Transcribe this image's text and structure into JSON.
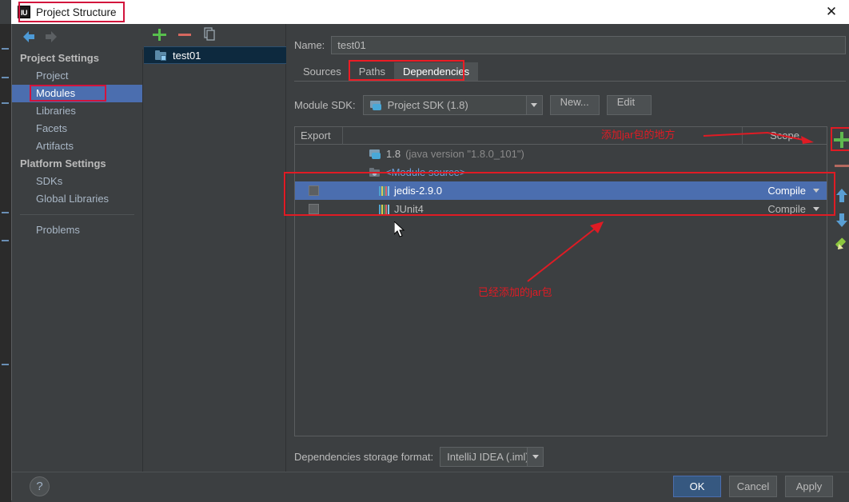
{
  "window": {
    "title": "Project Structure",
    "app_icon": "IU",
    "close_icon": "✕"
  },
  "nav": {
    "back_icon": "back-arrow-icon",
    "forward_icon": "forward-arrow-icon"
  },
  "sidebar": {
    "groups": [
      {
        "header": "Project Settings",
        "items": [
          {
            "label": "Project",
            "selected": false
          },
          {
            "label": "Modules",
            "selected": true
          },
          {
            "label": "Libraries",
            "selected": false
          },
          {
            "label": "Facets",
            "selected": false
          },
          {
            "label": "Artifacts",
            "selected": false
          }
        ]
      },
      {
        "header": "Platform Settings",
        "items": [
          {
            "label": "SDKs",
            "selected": false
          },
          {
            "label": "Global Libraries",
            "selected": false
          }
        ]
      }
    ],
    "problems_label": "Problems"
  },
  "module_panel": {
    "toolbar": {
      "add_icon": "plus-icon",
      "remove_icon": "minus-icon",
      "copy_icon": "copy-icon"
    },
    "modules": [
      {
        "name": "test01",
        "selected": true
      }
    ]
  },
  "main": {
    "name_label": "Name:",
    "name_value": "test01",
    "tabs": [
      {
        "label": "Sources",
        "active": false
      },
      {
        "label": "Paths",
        "active": false
      },
      {
        "label": "Dependencies",
        "active": true
      }
    ],
    "sdk_label": "Module SDK:",
    "sdk_value": "Project SDK (1.8)",
    "new_button": "New...",
    "edit_button": "Edit",
    "table": {
      "columns": {
        "export": "Export",
        "scope": "Scope"
      },
      "rows": [
        {
          "name": "1.8",
          "detail": "(java version \"1.8.0_101\")",
          "icon": "sdk-icon",
          "checkbox": false,
          "has_checkbox": false,
          "scope": "",
          "selected": false,
          "style": "muted"
        },
        {
          "name": "<Module source>",
          "detail": "",
          "icon": "folder-icon",
          "checkbox": false,
          "has_checkbox": false,
          "scope": "",
          "selected": false,
          "style": "blue"
        },
        {
          "name": "jedis-2.9.0",
          "detail": "",
          "icon": "library-icon",
          "checkbox": false,
          "has_checkbox": true,
          "scope": "Compile",
          "selected": true,
          "style": "normal"
        },
        {
          "name": "JUnit4",
          "detail": "",
          "icon": "library-icon",
          "checkbox": false,
          "has_checkbox": true,
          "scope": "Compile",
          "selected": false,
          "style": "normal"
        }
      ]
    },
    "side_toolbar": {
      "add_icon": "plus-icon",
      "remove_icon": "minus-icon",
      "move_up_icon": "arrow-up-icon",
      "move_down_icon": "arrow-down-icon",
      "edit_icon": "pencil-icon"
    },
    "storage_label": "Dependencies storage format:",
    "storage_value": "IntelliJ IDEA (.iml)"
  },
  "footer": {
    "help_label": "?",
    "ok_label": "OK",
    "cancel_label": "Cancel",
    "apply_label": "Apply"
  },
  "annotations": {
    "top_note": "添加jar包的地方",
    "bottom_note": "已经添加的jar包",
    "highlight_color": "#e01b24"
  }
}
